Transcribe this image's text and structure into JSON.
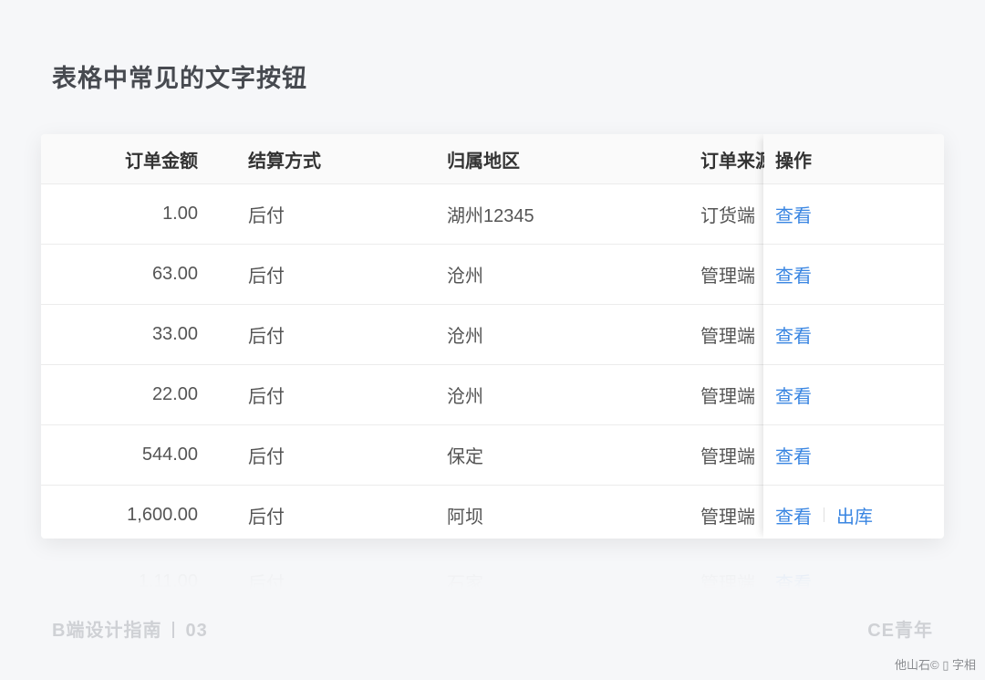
{
  "page_title": "表格中常见的文字按钮",
  "table": {
    "columns": {
      "amount": "订单金额",
      "payment": "结算方式",
      "region": "归属地区",
      "source": "订单来源",
      "actions": "操作"
    },
    "rows": [
      {
        "amount": "1.00",
        "payment": "后付",
        "region": "湖州12345",
        "source": "订货端",
        "actions": [
          "查看"
        ]
      },
      {
        "amount": "63.00",
        "payment": "后付",
        "region": "沧州",
        "source": "管理端",
        "actions": [
          "查看"
        ]
      },
      {
        "amount": "33.00",
        "payment": "后付",
        "region": "沧州",
        "source": "管理端",
        "actions": [
          "查看"
        ]
      },
      {
        "amount": "22.00",
        "payment": "后付",
        "region": "沧州",
        "source": "管理端",
        "actions": [
          "查看"
        ]
      },
      {
        "amount": "544.00",
        "payment": "后付",
        "region": "保定",
        "source": "管理端",
        "actions": [
          "查看"
        ]
      },
      {
        "amount": "1,600.00",
        "payment": "后付",
        "region": "阿坝",
        "source": "管理端",
        "actions": [
          "查看",
          "出库"
        ]
      }
    ],
    "faded_row": {
      "amount": "1.11.00",
      "payment": "后付",
      "region": "石家",
      "source": "管理端",
      "actions": [
        "查看"
      ]
    }
  },
  "footer": {
    "left_title": "B端设计指南",
    "left_number": "03",
    "right_brand": "CE青年"
  },
  "watermark": "他山石© ▯ 字相",
  "colors": {
    "background": "#f6f7f9",
    "link": "#3a86e2",
    "title": "#474a50",
    "footer": "#cfd1d5"
  }
}
